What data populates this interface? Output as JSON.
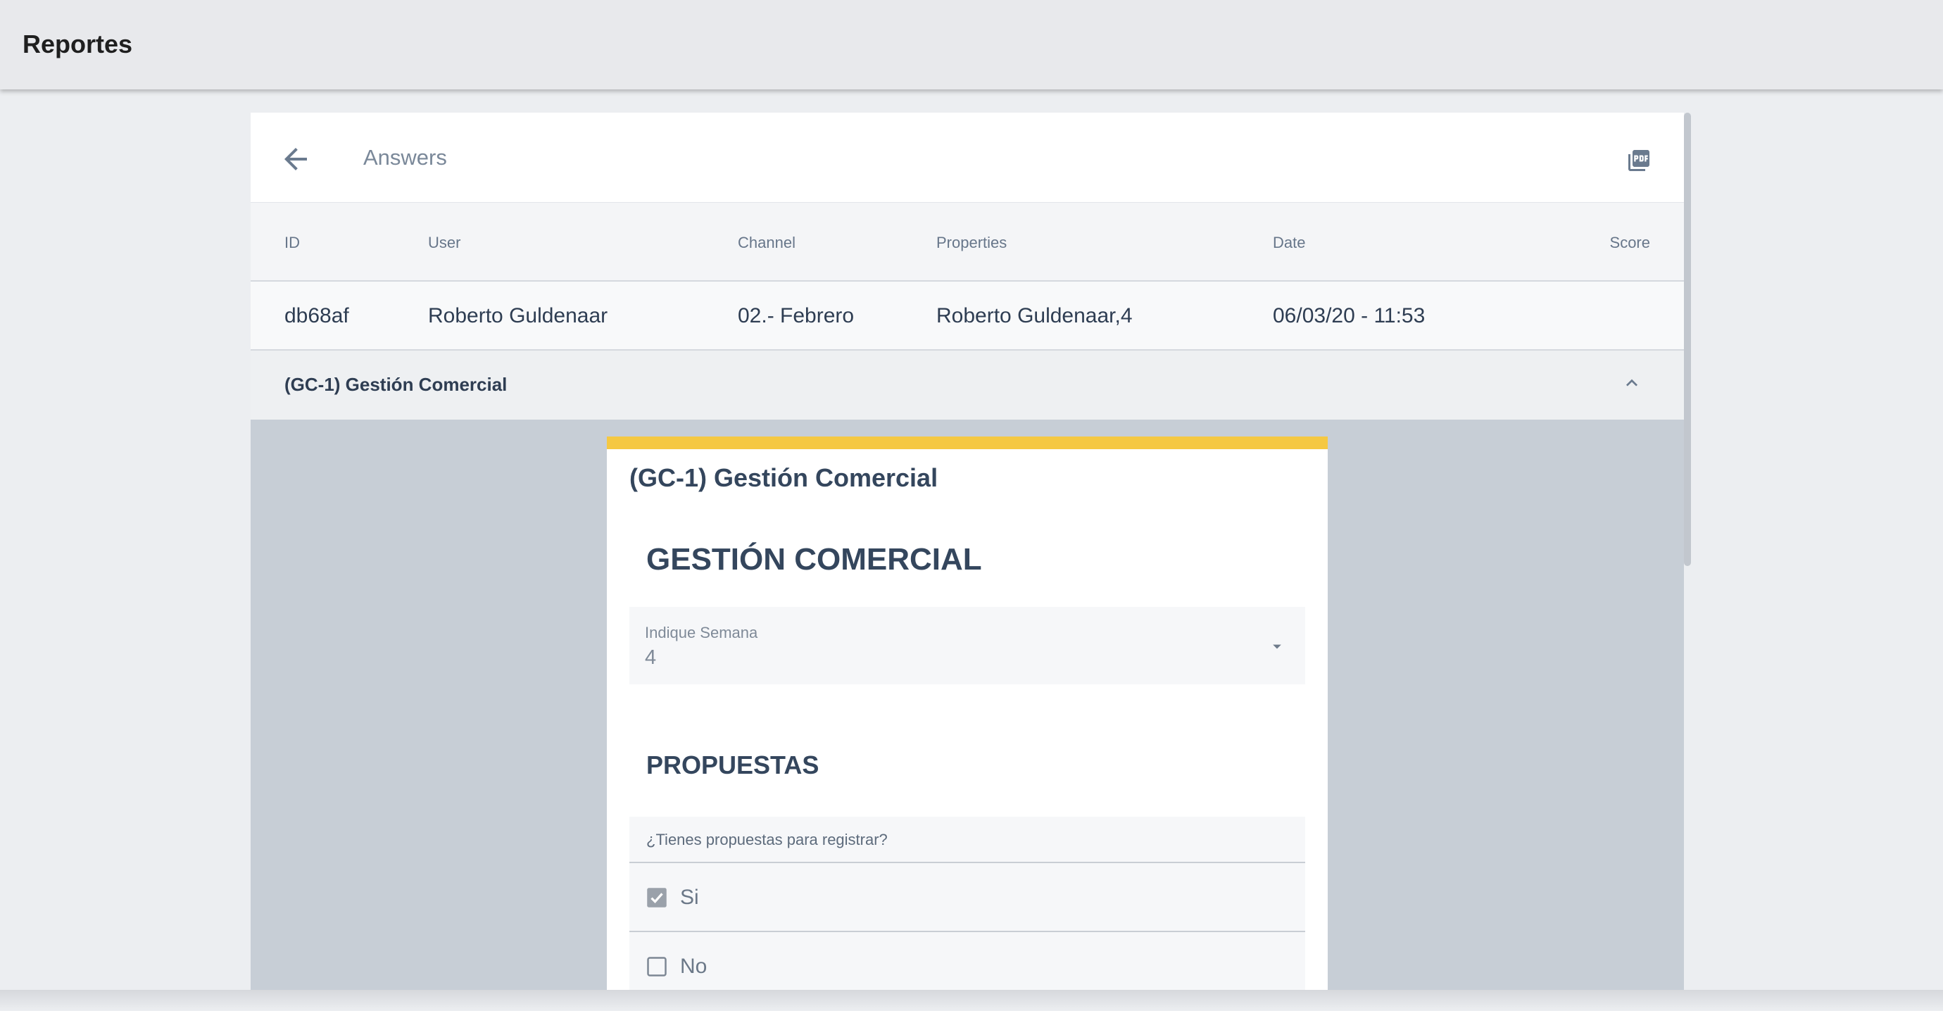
{
  "app": {
    "title": "Reportes"
  },
  "panel": {
    "title": "Answers"
  },
  "table": {
    "headers": [
      "ID",
      "User",
      "Channel",
      "Properties",
      "Date",
      "Score"
    ],
    "rows": [
      [
        "db68af",
        "Roberto Guldenaar",
        "02.- Febrero",
        "Roberto Guldenaar,4",
        "06/03/20 - 11:53",
        ""
      ]
    ]
  },
  "section": {
    "label": "(GC-1) Gestión Comercial"
  },
  "form": {
    "card_title": "(GC-1) Gestión Comercial",
    "accent_color": "#f5c842",
    "section1_title": "GESTIÓN COMERCIAL",
    "select": {
      "label": "Indique Semana",
      "value": "4"
    },
    "section2_title": "PROPUESTAS",
    "question": "¿Tienes propuestas para registrar?",
    "options": [
      {
        "label": "Si",
        "checked": true
      },
      {
        "label": "No",
        "checked": false
      }
    ]
  },
  "icons": {
    "back": "arrow-left-icon",
    "pdf": "pdf-icon",
    "collapse": "chevron-up-icon",
    "dropdown": "caret-down-icon"
  }
}
